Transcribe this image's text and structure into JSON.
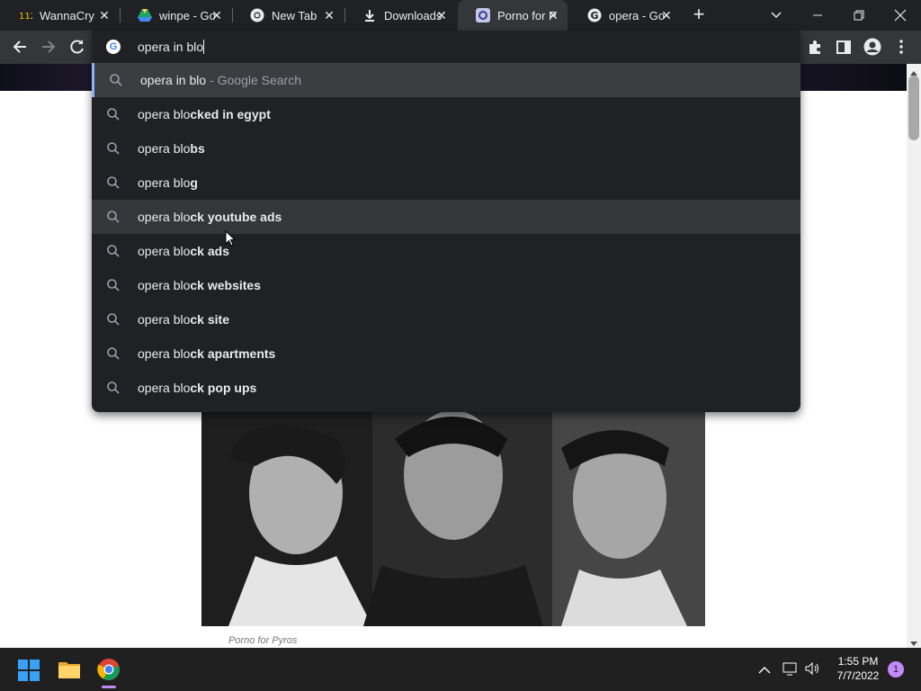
{
  "browser": {
    "tabs": [
      {
        "title": "WannaCry",
        "favicon": "wannacry-favicon"
      },
      {
        "title": "winpe - Go",
        "favicon": "google-drive-icon"
      },
      {
        "title": "New Tab",
        "favicon": "chrome-icon"
      },
      {
        "title": "Downloads",
        "favicon": "download-icon"
      },
      {
        "title": "Porno for P",
        "favicon": "site-favicon"
      },
      {
        "title": "opera - Go",
        "favicon": "google-icon"
      }
    ],
    "active_tab_index": 4
  },
  "omnibox": {
    "value": "opera in blo",
    "suggestions": [
      {
        "typed": "opera in blo",
        "rest": "",
        "hint": " - Google Search"
      },
      {
        "typed": "opera blo",
        "rest": "cked in egypt"
      },
      {
        "typed": "opera blo",
        "rest": "bs"
      },
      {
        "typed": "opera blo",
        "rest": "g"
      },
      {
        "typed": "opera blo",
        "rest": "ck youtube ads"
      },
      {
        "typed": "opera blo",
        "rest": "ck ads"
      },
      {
        "typed": "opera blo",
        "rest": "ck websites"
      },
      {
        "typed": "opera blo",
        "rest": "ck site"
      },
      {
        "typed": "opera blo",
        "rest": "ck apartments"
      },
      {
        "typed": "opera blo",
        "rest": "ck pop ups"
      }
    ]
  },
  "page": {
    "caption": "Porno for Pyros"
  },
  "taskbar": {
    "time": "1:55 PM",
    "date": "7/7/2022",
    "notification_count": "1"
  },
  "colors": {
    "browser_dark": "#202124",
    "toolbar": "#35363a",
    "text": "#e8eaed",
    "accent": "#8ab4f8"
  }
}
